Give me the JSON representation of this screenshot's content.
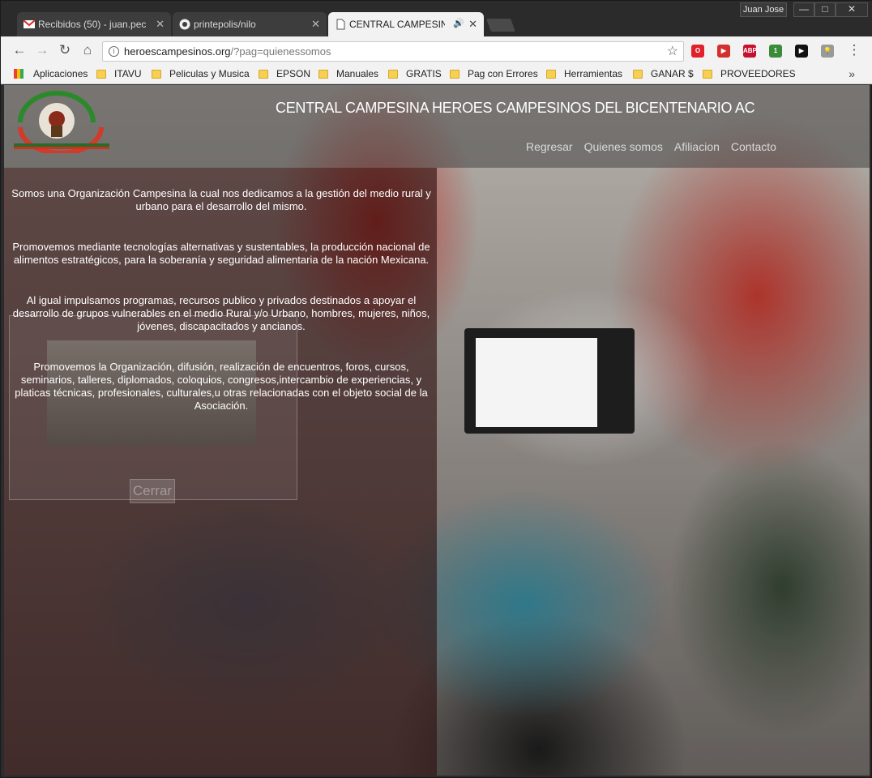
{
  "tabs": [
    {
      "label": "Recibidos (50) - juan.pec",
      "icon": "gmail-icon",
      "badge": "50+"
    },
    {
      "label": "printepolis/nilo",
      "icon": "github-icon"
    },
    {
      "label": "CENTRAL CAMPESINA",
      "icon": "page-icon",
      "audio": "speaker-icon",
      "active": true
    }
  ],
  "window": {
    "user": "Juan Jose",
    "minimize": "—",
    "restore": "□",
    "close": "✕"
  },
  "toolbar": {
    "back": "←",
    "forward": "→",
    "reload": "↻",
    "home": "⌂",
    "url_domain": "heroescampesinos.org",
    "url_path": "/?pag=quienessomos",
    "star": "☆",
    "menu": "⋮"
  },
  "extensions": [
    {
      "name": "opera-icon",
      "label": "O",
      "color": "#e0202a"
    },
    {
      "name": "recorder-icon",
      "label": "▶",
      "color": "#d32f2f"
    },
    {
      "name": "adblock-icon",
      "label": "ABP",
      "color": "#c8102e"
    },
    {
      "name": "colorful-icon",
      "label": "1",
      "color": "#3a8b3a"
    },
    {
      "name": "youtube-icon",
      "label": "▶",
      "color": "#111111"
    },
    {
      "name": "bulb-icon",
      "label": "💡",
      "color": "#999999"
    }
  ],
  "bookmarks": [
    {
      "label": "Aplicaciones",
      "type": "apps"
    },
    {
      "label": "ITAVU",
      "type": "folder"
    },
    {
      "label": "Peliculas y Musica",
      "type": "folder"
    },
    {
      "label": "EPSON",
      "type": "folder"
    },
    {
      "label": "Manuales",
      "type": "folder"
    },
    {
      "label": "GRATIS",
      "type": "folder"
    },
    {
      "label": "Pag con Errores",
      "type": "folder"
    },
    {
      "label": "Herramientas",
      "type": "folder"
    },
    {
      "label": "GANAR $",
      "type": "folder"
    },
    {
      "label": "PROVEEDORES",
      "type": "folder"
    }
  ],
  "bookmarks_more": "»",
  "site": {
    "title": "CENTRAL CAMPESINA HEROES CAMPESINOS DEL BICENTENARIO AC",
    "nav": [
      "Regresar",
      "Quienes somos",
      "Afiliacion",
      "Contacto"
    ],
    "paragraphs": [
      "Somos una Organización Campesina la cual nos dedicamos a la gestión del medio rural y urbano para el desarrollo del mismo.",
      "Promovemos mediante tecnologías alternativas y sustentables, la producción nacional de alimentos estratégicos, para la soberanía y seguridad alimentaria de la nación Mexicana.",
      "Al igual impulsamos programas, recursos publico y privados destinados a apoyar el desarrollo de grupos vulnerables en el medio Rural y/o Urbano, hombres, mujeres, niños, jóvenes, discapacitados y ancianos.",
      "Promovemos la Organización, difusión, realización de encuentros, foros, cursos, seminarios, talleres, diplomados, coloquios, congresos,intercambio de experiencias, y platicas técnicas, profesionales, culturales,u otras relacionadas con el objeto social de la Asociación."
    ],
    "close_button": "Cerrar"
  },
  "colors": {
    "chrome_dark": "#2b2b2b",
    "toolbar": "#f2f2f2",
    "overlay_left": "rgba(45,15,15,0.62)"
  }
}
